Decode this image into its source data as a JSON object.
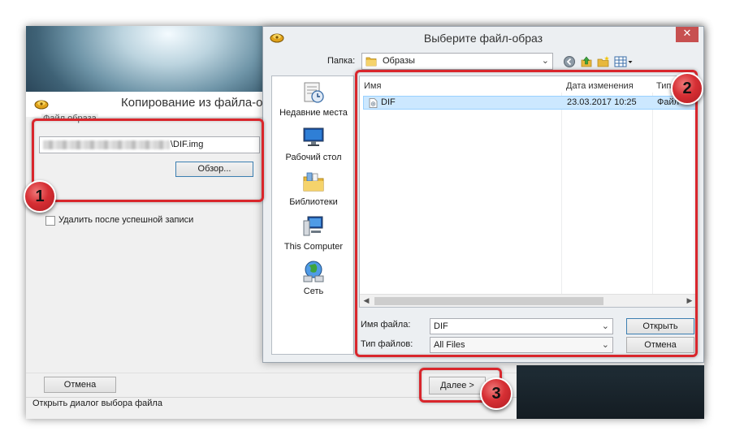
{
  "main_window": {
    "title": "Копирование из файла-обр",
    "group_caption": "Файл образа",
    "path_value": "\\DIF.img",
    "browse_label": "Обзор...",
    "delete_after_label": "Удалить после успешной записи",
    "delete_after_checked": false,
    "cancel_label": "Отмена",
    "next_label": "Далее >",
    "status_text": "Открыть диалог выбора файла"
  },
  "dialog": {
    "title": "Выберите файл-образ",
    "close_glyph": "✕",
    "folder_label": "Папка:",
    "folder_value": "Образы",
    "places": [
      {
        "label": "Недавние места",
        "icon": "recent-places-icon"
      },
      {
        "label": "Рабочий стол",
        "icon": "desktop-icon"
      },
      {
        "label": "Библиотеки",
        "icon": "libraries-icon"
      },
      {
        "label": "This Computer",
        "icon": "computer-icon"
      },
      {
        "label": "Сеть",
        "icon": "network-icon"
      }
    ],
    "columns": {
      "name": "Имя",
      "date": "Дата изменения",
      "type": "Тип"
    },
    "files": [
      {
        "name": "DIF",
        "date": "23.03.2017 10:25",
        "type": "Файл",
        "selected": true
      }
    ],
    "file_name_label": "Имя файла:",
    "file_name_value": "DIF",
    "file_type_label": "Тип файлов:",
    "file_type_value": "All Files",
    "open_label": "Открыть",
    "cancel_label": "Отмена"
  },
  "annotations": [
    {
      "number": "1"
    },
    {
      "number": "2"
    },
    {
      "number": "3"
    }
  ],
  "colors": {
    "annotation_red": "#d9262c",
    "selection_blue": "#cce8ff",
    "close_red": "#c75050"
  }
}
